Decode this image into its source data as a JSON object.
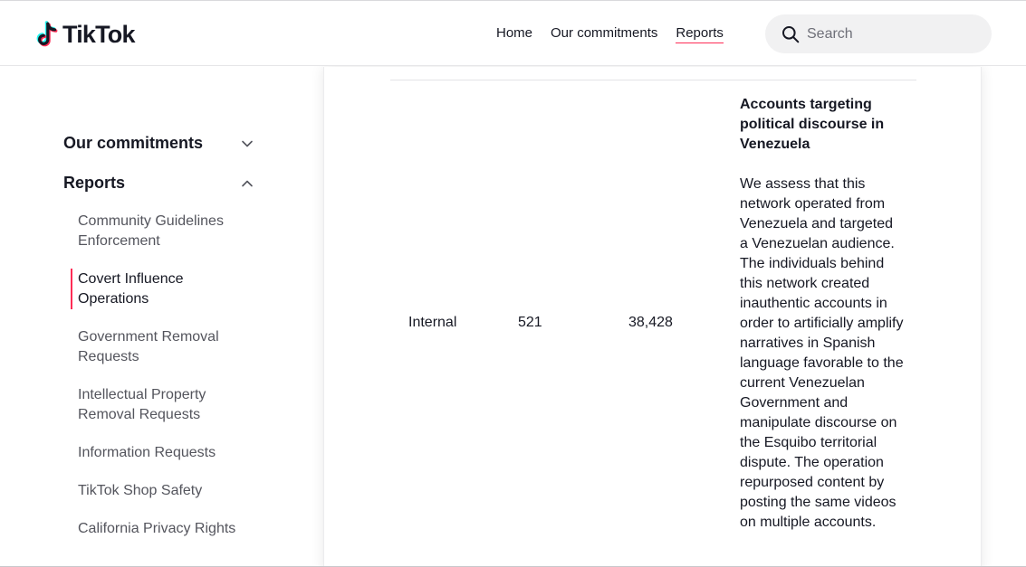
{
  "header": {
    "logo_text": "TikTok",
    "nav": [
      {
        "label": "Home"
      },
      {
        "label": "Our commitments"
      },
      {
        "label": "Reports"
      }
    ],
    "search_placeholder": "Search"
  },
  "sidebar": {
    "sections": [
      {
        "label": "Our commitments",
        "expanded": false
      },
      {
        "label": "Reports",
        "expanded": true
      }
    ],
    "items": [
      {
        "label": "Community Guidelines Enforcement"
      },
      {
        "label": "Covert Influence Operations",
        "active": true
      },
      {
        "label": "Government Removal Requests"
      },
      {
        "label": "Intellectual Property Removal Requests"
      },
      {
        "label": "Information Requests"
      },
      {
        "label": "TikTok Shop Safety"
      },
      {
        "label": "California Privacy Rights"
      }
    ]
  },
  "table": {
    "row": {
      "detection": "Internal",
      "accounts": "521",
      "followers": "38,428",
      "title": "Accounts targeting political discourse in Venezuela",
      "description": "We assess that this network operated from Venezuela and targeted a Venezuelan audience. The individuals behind this network created inauthentic accounts in order to artificially amplify narratives in Spanish language favorable to the current Venezuelan Government and manipulate discourse on the Esquibo territorial dispute. The operation repurposed content by posting the same videos on multiple accounts."
    }
  },
  "colors": {
    "accent": "#fe2c55",
    "accent_cyan": "#25f4ee",
    "text": "#161823",
    "muted": "#54555d",
    "search_bg": "#f1f1f2"
  },
  "icons": {
    "logo": "tiktok-note-icon",
    "search": "search-icon",
    "collapsed": "chevron-down-icon",
    "expanded": "chevron-up-icon"
  }
}
